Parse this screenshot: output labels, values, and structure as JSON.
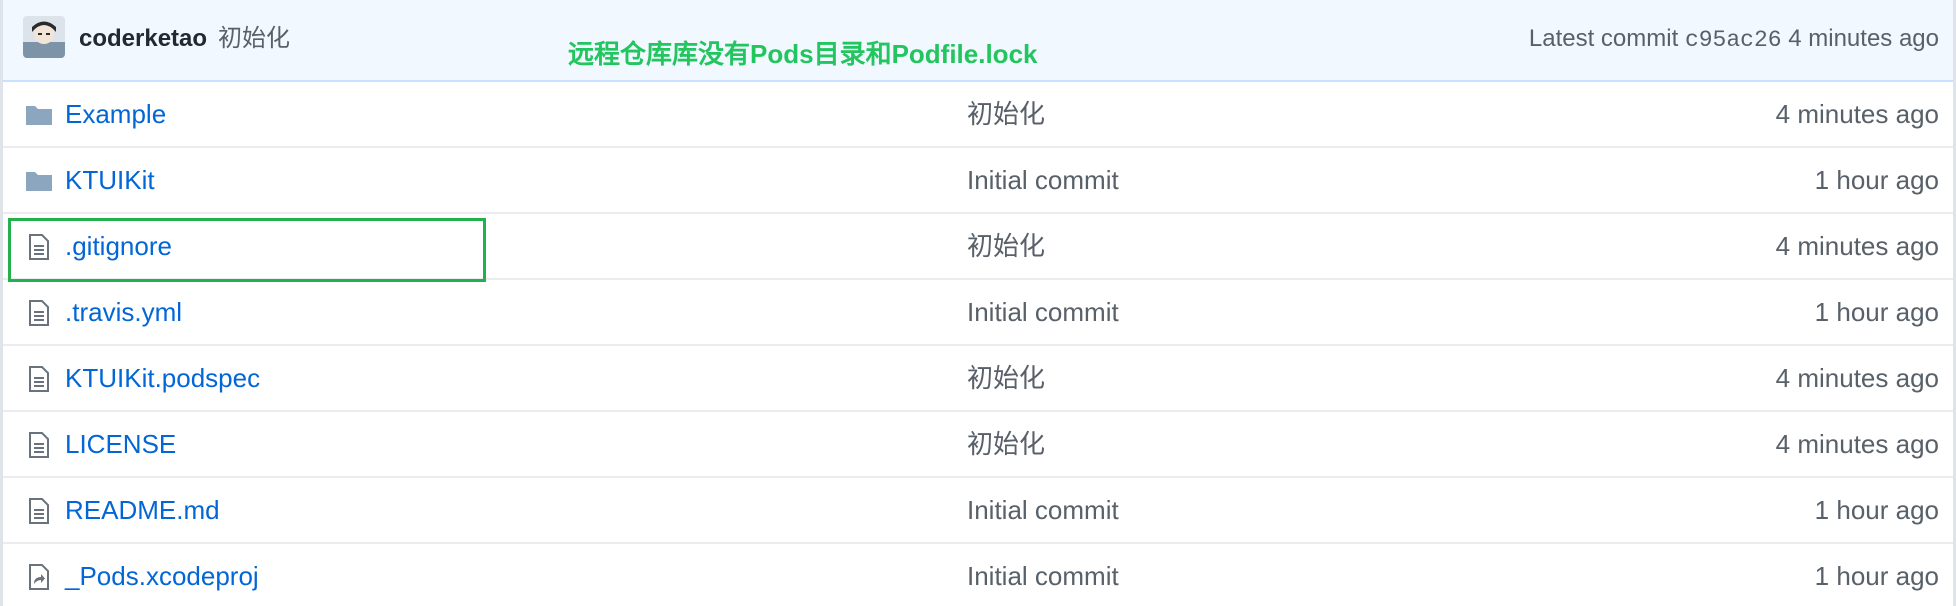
{
  "header": {
    "author": "coderketao",
    "commit_message": "初始化",
    "annotation": "远程仓库库没有Pods目录和Podfile.lock",
    "latest_label": "Latest commit",
    "latest_sha": "c95ac26",
    "latest_age": "4 minutes ago"
  },
  "files": [
    {
      "name": "Example",
      "type": "folder",
      "message": "初始化",
      "age": "4 minutes ago"
    },
    {
      "name": "KTUIKit",
      "type": "folder",
      "message": "Initial commit",
      "age": "1 hour ago"
    },
    {
      "name": ".gitignore",
      "type": "file",
      "message": "初始化",
      "age": "4 minutes ago"
    },
    {
      "name": ".travis.yml",
      "type": "file",
      "message": "Initial commit",
      "age": "1 hour ago"
    },
    {
      "name": "KTUIKit.podspec",
      "type": "file",
      "message": "初始化",
      "age": "4 minutes ago"
    },
    {
      "name": "LICENSE",
      "type": "file",
      "message": "初始化",
      "age": "4 minutes ago"
    },
    {
      "name": "README.md",
      "type": "file",
      "message": "Initial commit",
      "age": "1 hour ago"
    },
    {
      "name": "_Pods.xcodeproj",
      "type": "symlink",
      "message": "Initial commit",
      "age": "1 hour ago"
    }
  ],
  "colors": {
    "link": "#0366d6",
    "muted": "#586069",
    "annotation": "#22c55e",
    "highlight_box": "#22b14c",
    "header_bg": "#f1f8ff"
  },
  "icons": {
    "folder": "folder-icon",
    "file": "file-icon",
    "symlink": "symlink-file-icon"
  }
}
